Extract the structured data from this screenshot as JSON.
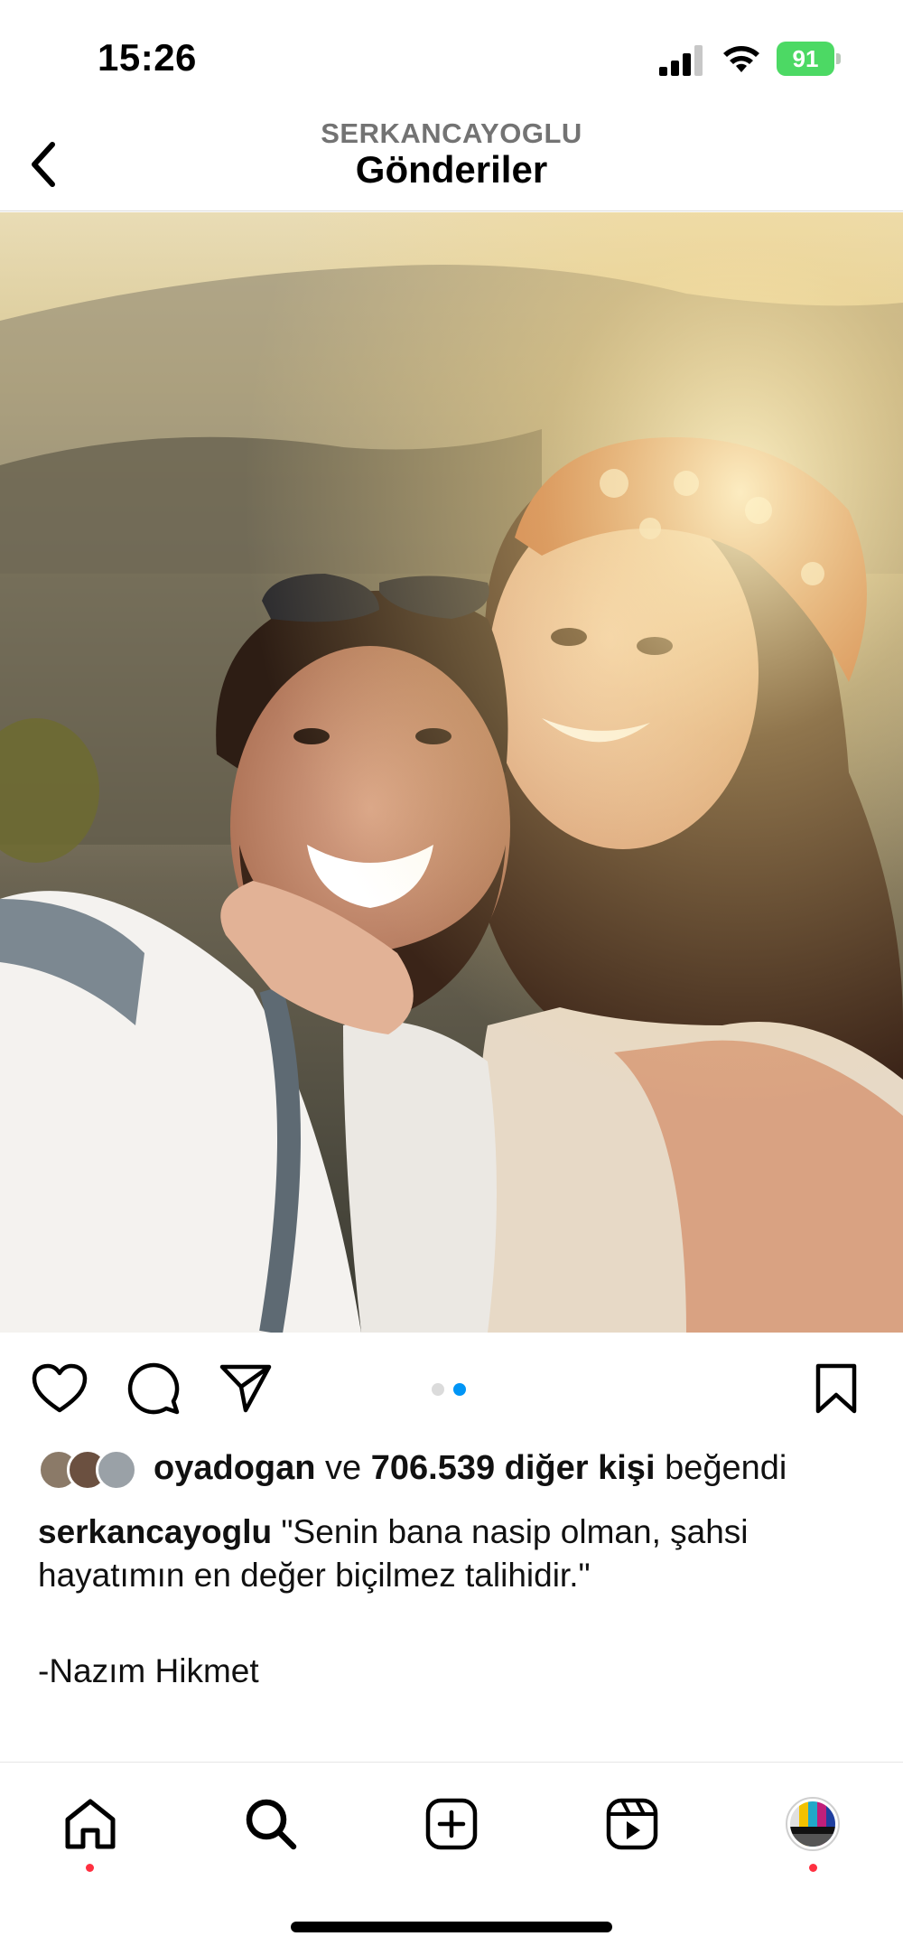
{
  "status_bar": {
    "time": "15:26",
    "battery": "91",
    "icons": [
      "signal-icon",
      "wifi-icon",
      "battery-icon"
    ]
  },
  "header": {
    "username": "SERKANCAYOGLU",
    "title": "Gönderiler",
    "back_icon": "chevron-left-icon"
  },
  "post": {
    "image_alt": "Selfie photo",
    "carousel": {
      "count": 2,
      "active_index": 1,
      "active_color": "#0095f6",
      "inactive_color": "#dbdbdb"
    },
    "actions": [
      "heart-icon",
      "comment-icon",
      "share-icon",
      "bookmark-icon"
    ],
    "likes": {
      "first_liker": "oyadogan",
      "connector": "ve",
      "others": "706.539 diğer kişi",
      "suffix": "beğendi"
    },
    "caption": {
      "author": "serkancayoglu",
      "line1": "\"Senin bana nasip olman, şahsi",
      "line2": "hayatımın en değer biçilmez talihidir.\"",
      "line3": "-Nazım Hikmet"
    }
  },
  "bottom_nav": {
    "items": [
      "home-icon",
      "search-icon",
      "create-icon",
      "reels-icon",
      "profile-avatar"
    ],
    "notification_color": "#ff3040"
  }
}
